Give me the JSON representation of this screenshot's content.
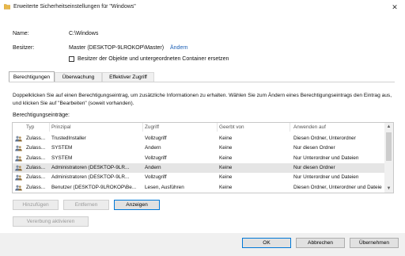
{
  "window": {
    "title": "Erweiterte Sicherheitseinstellungen für \"Windows\"",
    "close_glyph": "✕"
  },
  "properties": {
    "name_label": "Name:",
    "name_value": "C:\\Windows",
    "owner_label": "Besitzer:",
    "owner_value": "Master (DESKTOP-9LROKOP\\Master)",
    "owner_change_link": "Ändern",
    "replace_owner_checkbox_label": "Besitzer der Objekte und untergeordneten Container ersetzen",
    "replace_owner_checked": false
  },
  "tabs": [
    {
      "label": "Berechtigungen",
      "active": true
    },
    {
      "label": "Überwachung",
      "active": false
    },
    {
      "label": "Effektiver Zugriff",
      "active": false
    }
  ],
  "description": "Doppelklicken Sie auf einen Berechtigungseintrag, um zusätzliche Informationen zu erhalten. Wählen Sie zum Ändern eines Berechtigungseintrags den Eintrag aus, und klicken Sie auf \"Bearbeiten\" (soweit vorhanden).",
  "list_label": "Berechtigungseinträge:",
  "columns": [
    "Typ",
    "Prinzipal",
    "Zugriff",
    "Geerbt von",
    "Anwenden auf"
  ],
  "entries": [
    {
      "type": "Zulass...",
      "principal": "TrustedInstaller",
      "access": "Vollzugriff",
      "inherited": "Keine",
      "applies": "Diesen Ordner, Unterordner",
      "selected": false
    },
    {
      "type": "Zulass...",
      "principal": "SYSTEM",
      "access": "Ändern",
      "inherited": "Keine",
      "applies": "Nur diesen Ordner",
      "selected": false
    },
    {
      "type": "Zulass...",
      "principal": "SYSTEM",
      "access": "Vollzugriff",
      "inherited": "Keine",
      "applies": "Nur Unterordner und Dateien",
      "selected": false
    },
    {
      "type": "Zulass...",
      "principal": "Administratoren (DESKTOP-9LR...",
      "access": "Ändern",
      "inherited": "Keine",
      "applies": "Nur diesen Ordner",
      "selected": true
    },
    {
      "type": "Zulass...",
      "principal": "Administratoren (DESKTOP-9LR...",
      "access": "Vollzugriff",
      "inherited": "Keine",
      "applies": "Nur Unterordner und Dateien",
      "selected": false
    },
    {
      "type": "Zulass...",
      "principal": "Benutzer (DESKTOP-9LROKOP\\Be...",
      "access": "Lesen, Ausführen",
      "inherited": "Keine",
      "applies": "Diesen Ordner, Unterordner und Dateien",
      "selected": false
    }
  ],
  "scroll": {
    "up_glyph": "▲",
    "down_glyph": "▼"
  },
  "buttons": {
    "add": "Hinzufügen",
    "remove": "Entfernen",
    "view": "Anzeigen",
    "disable_inheritance": "Vererbung aktivieren",
    "ok": "OK",
    "cancel": "Abbrechen",
    "apply": "Übernehmen"
  },
  "colors": {
    "link": "#1b5fb5",
    "selection": "#e5e5e5",
    "focus_border": "#0078d7"
  }
}
